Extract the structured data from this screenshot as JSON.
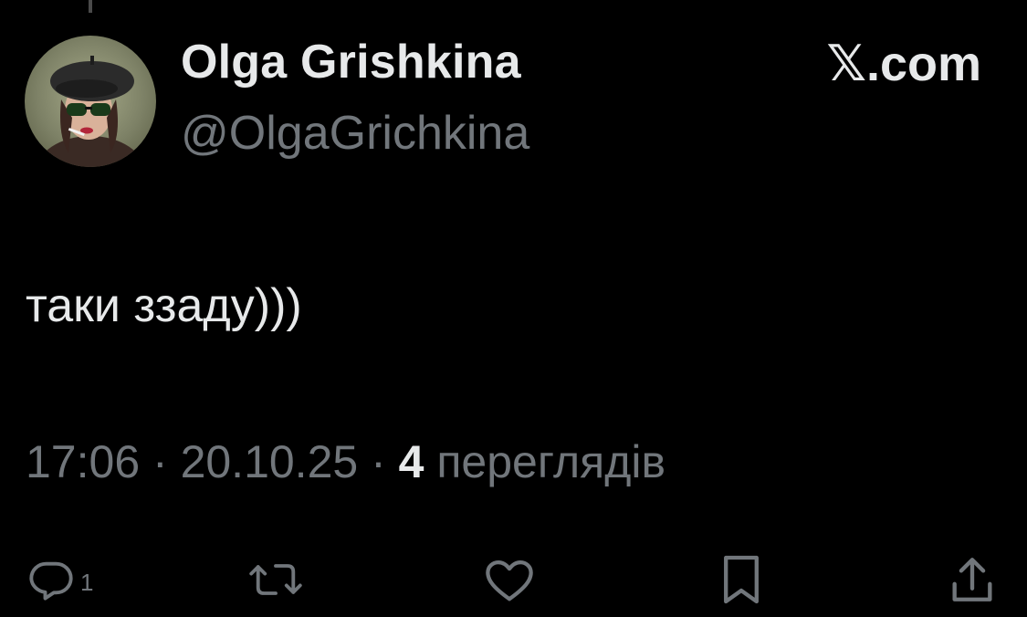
{
  "author": {
    "display_name": "Olga Grishkina",
    "handle": "@OlgaGrichkina",
    "avatar_icon": "avatar-portrait-icon"
  },
  "brand": "𝕏.com",
  "tweet": {
    "text": "таки ззаду)))"
  },
  "meta": {
    "time": "17:06",
    "separator": " · ",
    "date": "20.10.25",
    "views_count": "4",
    "views_label": "переглядів"
  },
  "actions": {
    "reply_count": "1",
    "icons": [
      "reply-icon",
      "retweet-icon",
      "like-icon",
      "bookmark-icon",
      "share-icon"
    ]
  },
  "colors": {
    "background": "#000000",
    "primary_text": "#e7e9ea",
    "secondary_text": "#71767b"
  }
}
